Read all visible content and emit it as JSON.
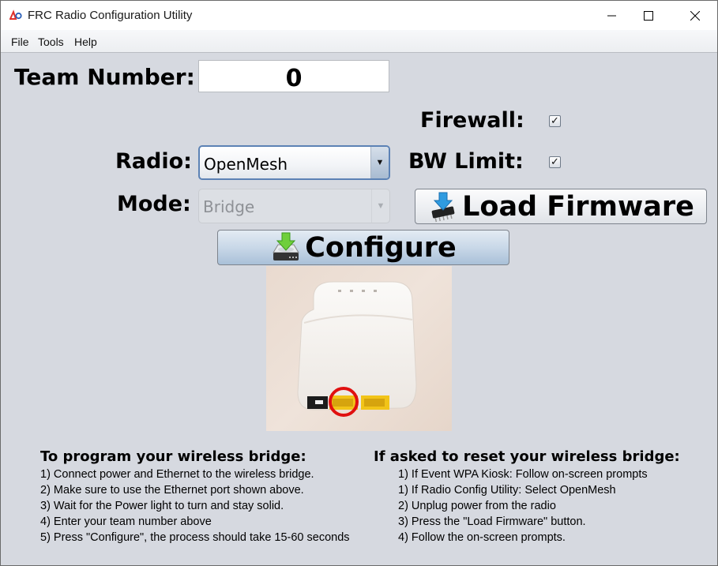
{
  "window": {
    "title": "FRC Radio Configuration Utility",
    "controls": {
      "minimize": "minimize-icon",
      "maximize": "maximize-icon",
      "close": "close-icon"
    }
  },
  "menubar": {
    "items": [
      {
        "label": "File"
      },
      {
        "label": "Tools"
      },
      {
        "label": "Help"
      }
    ]
  },
  "form": {
    "team_label": "Team Number:",
    "team_value": "0",
    "firewall_label": "Firewall:",
    "firewall_checked": true,
    "bw_label": "BW Limit:",
    "bw_checked": true,
    "checkmark": "✓",
    "radio_label": "Radio:",
    "radio_value": "OpenMesh",
    "mode_label": "Mode:",
    "mode_value": "Bridge",
    "mode_enabled": false,
    "dropdown_arrow": "▼"
  },
  "buttons": {
    "load_firmware": {
      "label": "Load Firmware",
      "icon": "firmware-chip-download-icon"
    },
    "configure": {
      "label": "Configure",
      "icon": "drive-download-icon"
    }
  },
  "image": {
    "description": "OpenMesh radio photo with Ethernet port circled in red"
  },
  "instructions": {
    "program": {
      "title": "To program your wireless bridge:",
      "steps": [
        "1) Connect power and Ethernet to the wireless bridge.",
        "2) Make sure to use the Ethernet port shown above.",
        "3) Wait for the Power light to turn and stay solid.",
        "4) Enter your team number above",
        "5) Press \"Configure\", the process should take 15-60 seconds"
      ]
    },
    "reset": {
      "title": "If asked to reset your wireless bridge:",
      "steps": [
        "1) If Event WPA Kiosk: Follow on-screen prompts",
        "1) If Radio Config Utility: Select OpenMesh",
        "2) Unplug power from the radio",
        "3) Press the \"Load Firmware\" button.",
        "4) Follow the on-screen prompts."
      ]
    }
  }
}
